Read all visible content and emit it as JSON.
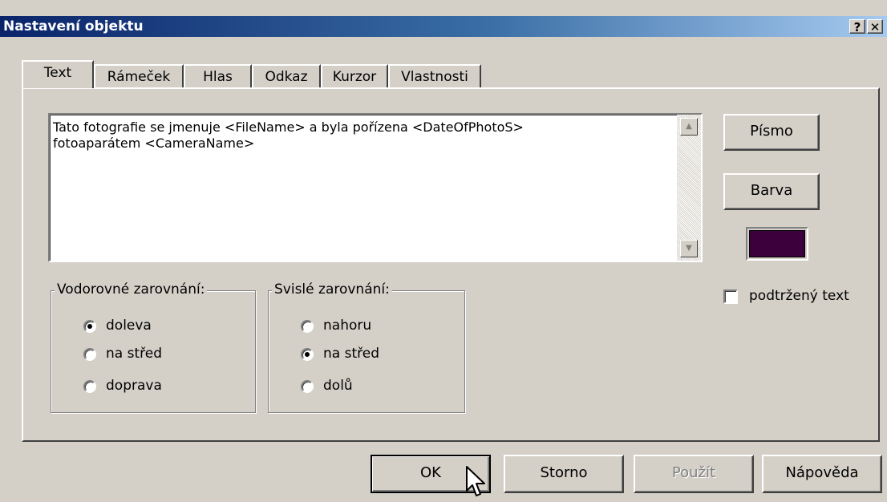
{
  "window": {
    "title": "Nastavení objektu",
    "help_glyph": "?",
    "close_glyph": "✕"
  },
  "tabs": [
    {
      "label": "Text",
      "active": true
    },
    {
      "label": "Rámeček"
    },
    {
      "label": "Hlas"
    },
    {
      "label": "Odkaz"
    },
    {
      "label": "Kurzor"
    },
    {
      "label": "Vlastnosti"
    }
  ],
  "text_panel": {
    "content": "Tato fotografie se jmenuje <FileName> a byla pořízena <DateOfPhotoS>\nfotoaparátem <CameraName>"
  },
  "buttons": {
    "font": "Písmo",
    "color": "Barva",
    "ok": "OK",
    "cancel": "Storno",
    "apply": "Použít",
    "help": "Nápověda"
  },
  "color_swatch": {
    "value": "#3c003c"
  },
  "underline": {
    "label": "podtržený text",
    "checked": false
  },
  "horizontal_align": {
    "legend": "Vodorovné zarovnání:",
    "options": [
      "doleva",
      "na střed",
      "doprava"
    ],
    "selected": "doleva"
  },
  "vertical_align": {
    "legend": "Svislé zarovnání:",
    "options": [
      "nahoru",
      "na střed",
      "dolů"
    ],
    "selected": "na střed"
  },
  "icons": {
    "scroll_up": "scroll-up-arrow-icon",
    "scroll_down": "scroll-down-arrow-icon",
    "cursor": "mouse-pointer-icon"
  }
}
